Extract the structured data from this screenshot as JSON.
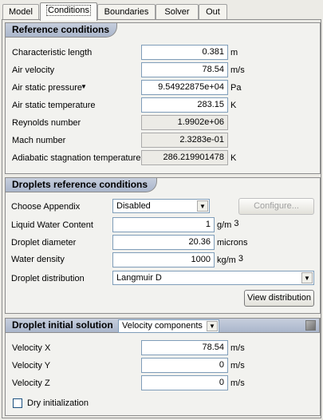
{
  "tabs": [
    "Model",
    "Conditions",
    "Boundaries",
    "Solver",
    "Out"
  ],
  "reference": {
    "title": "Reference conditions",
    "rows": [
      {
        "label": "Characteristic length",
        "value": "0.381",
        "unit": "m"
      },
      {
        "label": "Air velocity",
        "value": "78.54",
        "unit": "m/s"
      },
      {
        "label": "Air static pressure",
        "value": "9.54922875e+04",
        "unit": "Pa"
      },
      {
        "label": "Air static temperature",
        "value": "283.15",
        "unit": "K"
      },
      {
        "label": "Reynolds number",
        "value": "1.9902e+06",
        "unit": ""
      },
      {
        "label": "Mach number",
        "value": "2.3283e-01",
        "unit": ""
      },
      {
        "label": "Adiabatic stagnation temperature",
        "value": "286.219901478",
        "unit": "K"
      }
    ],
    "pressure_marker": "▼"
  },
  "droplets": {
    "title": "Droplets reference conditions",
    "appendix_label": "Choose Appendix",
    "appendix_value": "Disabled",
    "configure_label": "Configure...",
    "lwc_label": "Liquid Water Content",
    "lwc_value": "1",
    "lwc_unit": "g/m",
    "lwc_unit_sup": "3",
    "diam_label": "Droplet diameter",
    "diam_value": "20.36",
    "diam_unit": "microns",
    "density_label": "Water density",
    "density_value": "1000",
    "density_unit": "kg/m",
    "density_unit_sup": "3",
    "distribution_label": "Droplet distribution",
    "distribution_value": "Langmuir D",
    "view_label": "View distribution"
  },
  "initial": {
    "title": "Droplet initial solution",
    "mode_value": "Velocity components",
    "rows": [
      {
        "label": "Velocity X",
        "value": "78.54",
        "unit": "m/s"
      },
      {
        "label": "Velocity Y",
        "value": "0",
        "unit": "m/s"
      },
      {
        "label": "Velocity Z",
        "value": "0",
        "unit": "m/s"
      }
    ],
    "dry_label": "Dry initialization"
  },
  "colors": {
    "header_top": "#c6cedd",
    "header_bottom": "#aab6cb",
    "field_border": "#7f9db9"
  }
}
